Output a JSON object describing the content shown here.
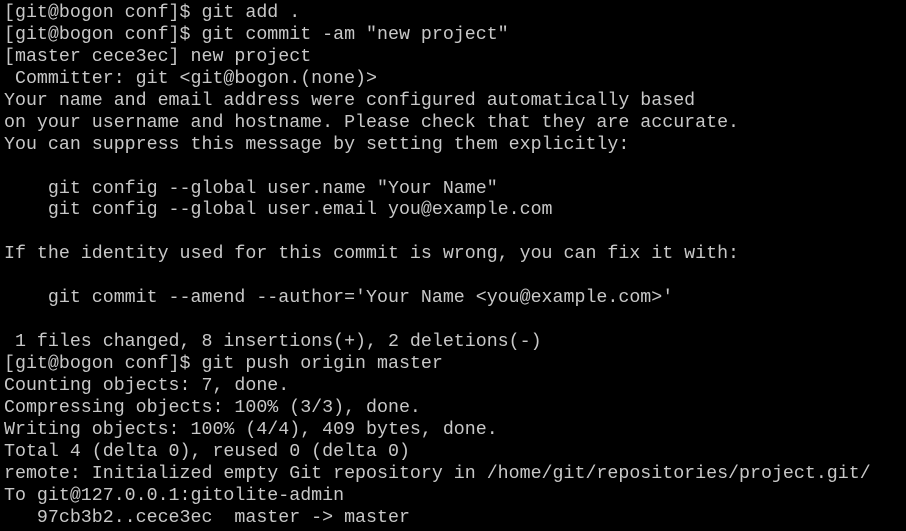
{
  "terminal": {
    "background": "#000000",
    "foreground": "#c8c8c8",
    "lines": [
      "[git@bogon conf]$ git add .",
      "[git@bogon conf]$ git commit -am \"new project\"",
      "[master cece3ec] new project",
      " Committer: git <git@bogon.(none)>",
      "Your name and email address were configured automatically based",
      "on your username and hostname. Please check that they are accurate.",
      "You can suppress this message by setting them explicitly:",
      "",
      "    git config --global user.name \"Your Name\"",
      "    git config --global user.email you@example.com",
      "",
      "If the identity used for this commit is wrong, you can fix it with:",
      "",
      "    git commit --amend --author='Your Name <you@example.com>'",
      "",
      " 1 files changed, 8 insertions(+), 2 deletions(-)",
      "[git@bogon conf]$ git push origin master",
      "Counting objects: 7, done.",
      "Compressing objects: 100% (3/3), done.",
      "Writing objects: 100% (4/4), 409 bytes, done.",
      "Total 4 (delta 0), reused 0 (delta 0)",
      "remote: Initialized empty Git repository in /home/git/repositories/project.git/",
      "To git@127.0.0.1:gitolite-admin",
      "   97cb3b2..cece3ec  master -> master"
    ]
  }
}
